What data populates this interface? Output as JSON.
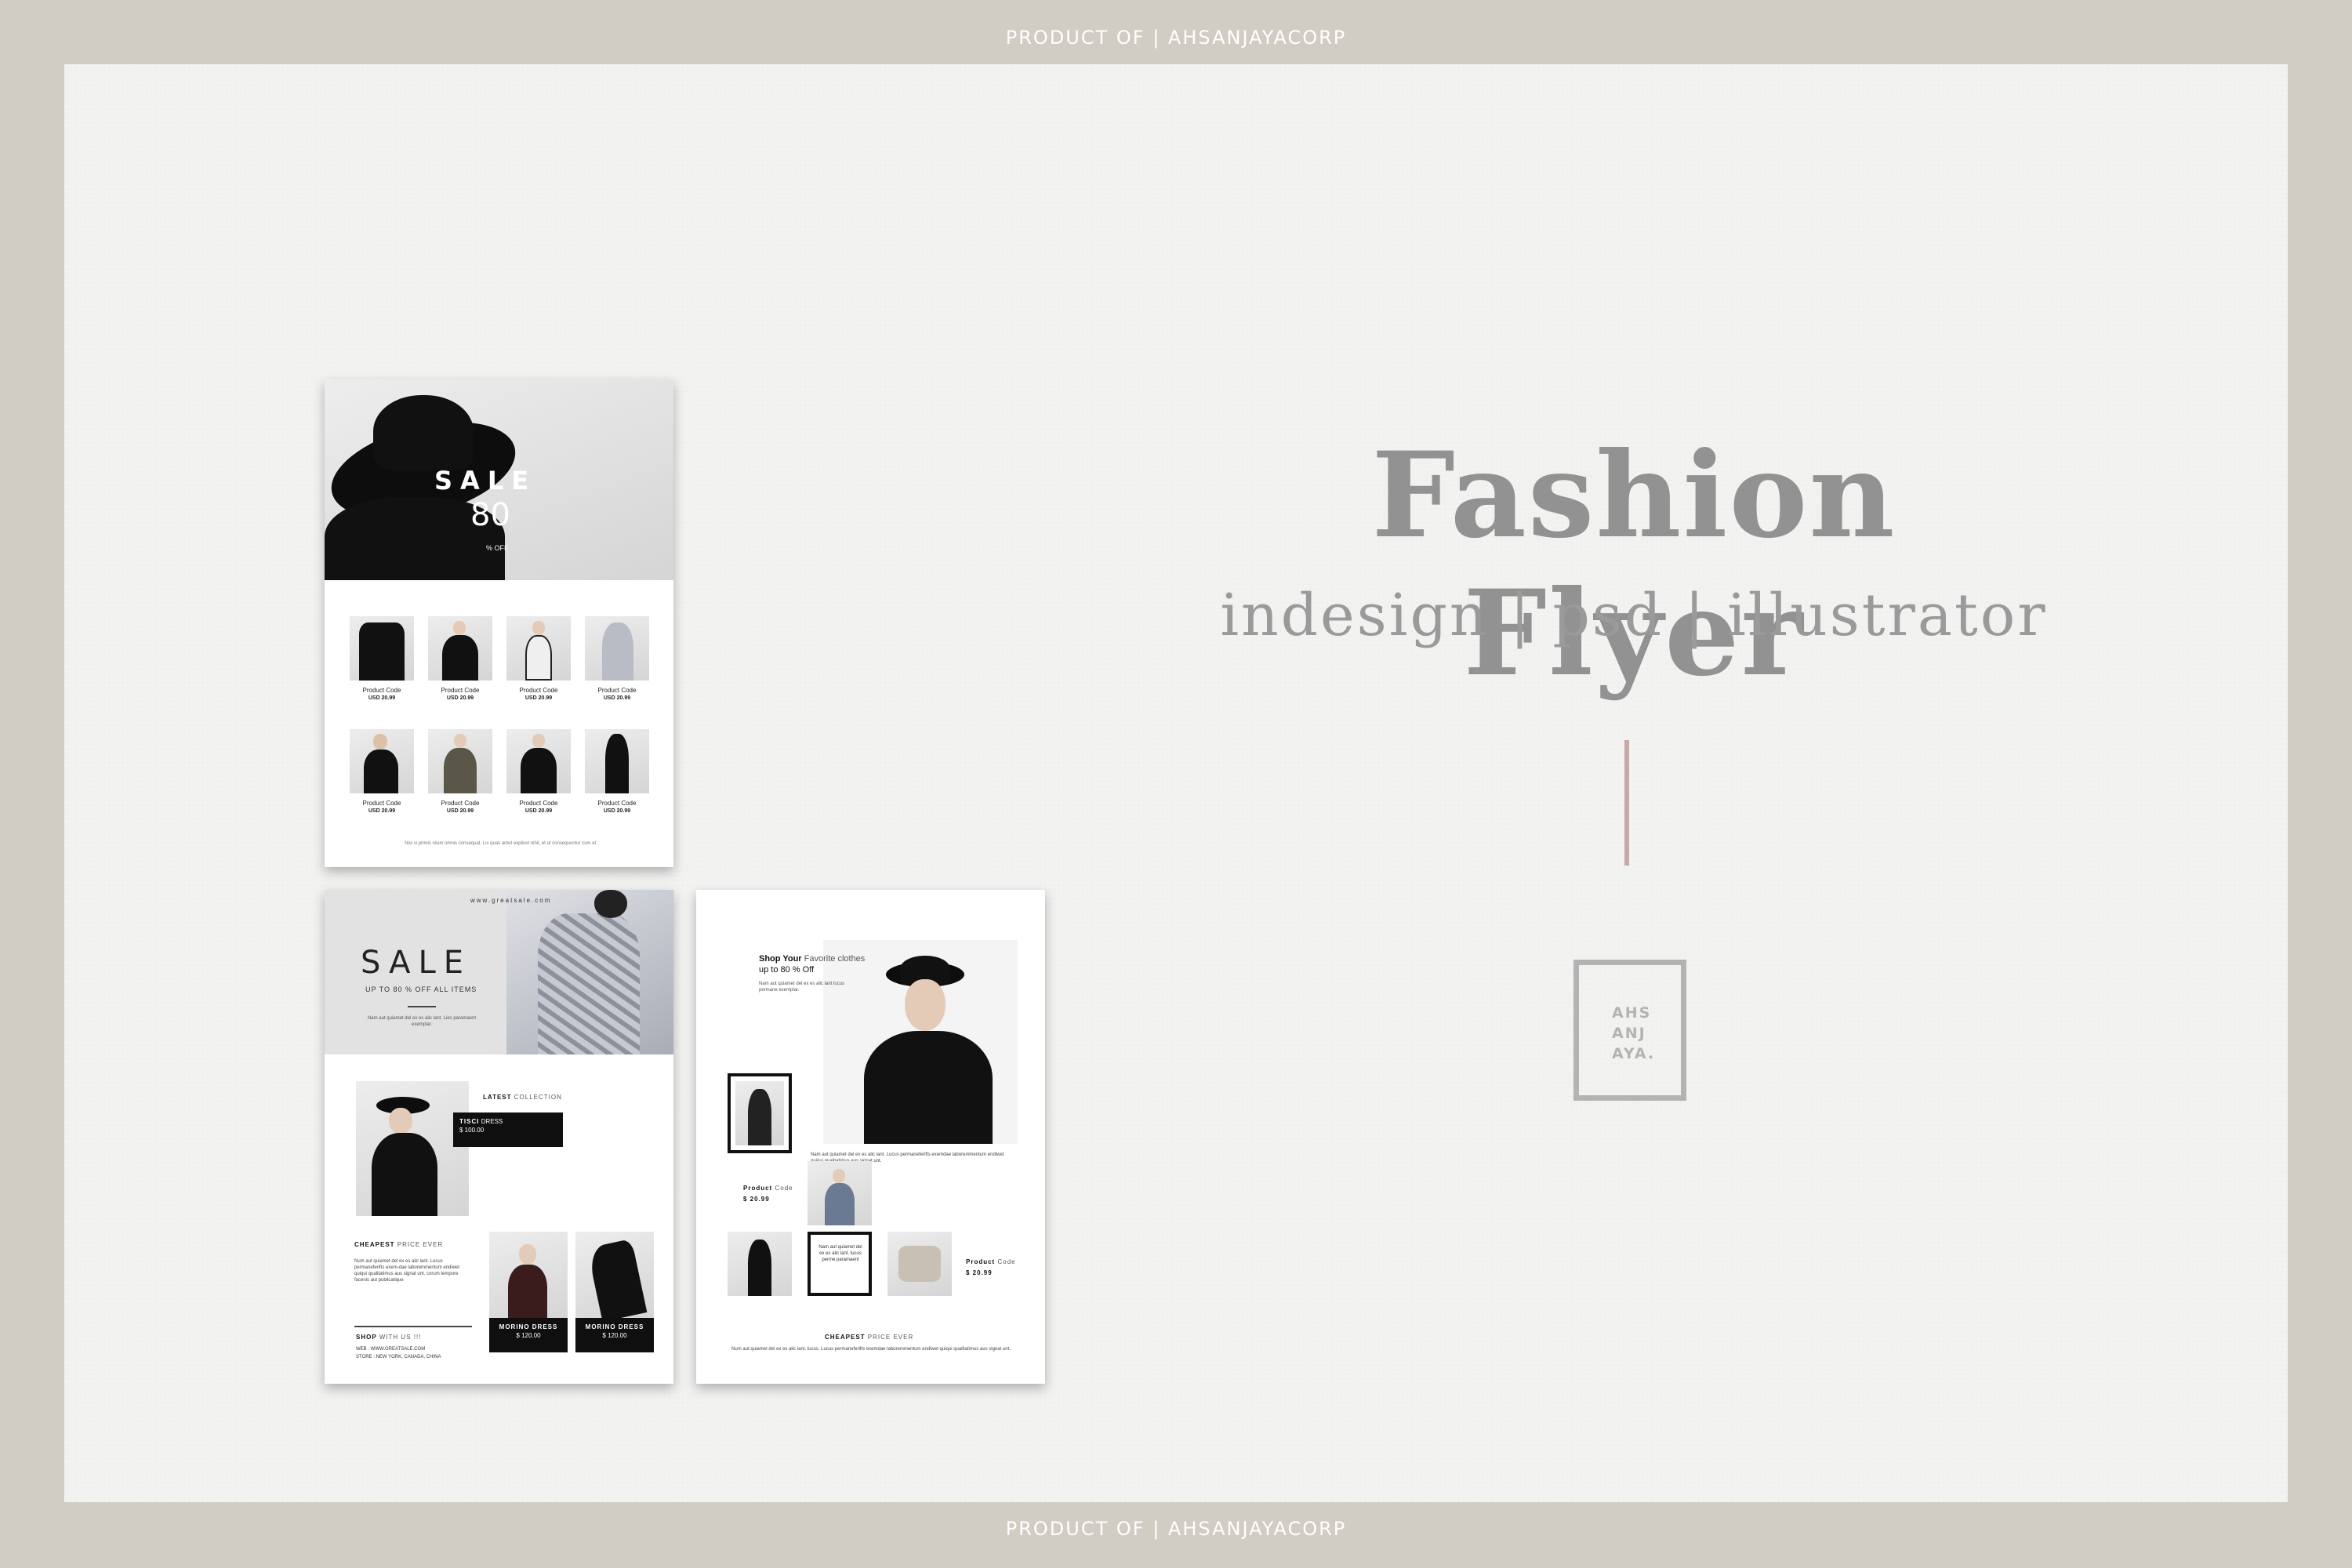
{
  "banner": {
    "top_text": "PRODUCT OF | AHSANJAYACORP",
    "bottom_text": "PRODUCT OF | AHSANJAYACORP"
  },
  "hero": {
    "title": "Fashion Flyer",
    "subtitle": "indesign | psd | illustrator",
    "accent_color": "#c4a9a4"
  },
  "logo": {
    "line1": "AHS",
    "line2": "ANJ",
    "line3": "AYA."
  },
  "flyer1": {
    "sale": "SALE",
    "discount": "80",
    "off": "% OFF",
    "products": [
      {
        "name": "Product Code",
        "price": "USD 20.99"
      },
      {
        "name": "Product Code",
        "price": "USD 20.99"
      },
      {
        "name": "Product Code",
        "price": "USD 20.99"
      },
      {
        "name": "Product Code",
        "price": "USD 20.99"
      },
      {
        "name": "Product Code",
        "price": "USD 20.99"
      },
      {
        "name": "Product Code",
        "price": "USD 20.99"
      },
      {
        "name": "Product Code",
        "price": "USD 20.99"
      },
      {
        "name": "Product Code",
        "price": "USD 20.99"
      }
    ],
    "footer": "Nisi si primis nisim omnis consequat. Lis quas amet explicet nihil, et ut consequuntur cum et."
  },
  "flyer2": {
    "url": "www.greatsale.com",
    "sale": "SALE",
    "sale_sub": "UP TO 80 % OFF ALL ITEMS",
    "intro": "Nam aut quiamet del ex es alic lant. Lies paramaent exemplar.",
    "latest_bold": "LATEST",
    "latest_rest": "COLLECTION",
    "tisci_bold": "TISCI",
    "tisci_rest": "DRESS",
    "tisci_price": "$ 100.00",
    "cheapest_bold": "CHEAPEST",
    "cheapest_rest": "PRICE EVER",
    "cheapest_body": "Num aut quiamet del ex es ailc lant. Lucus permaneferifts exem-dae laboremmentum endiwet quiqui qualitatimus aus signat unt. corum tempore facenis aut publicatique",
    "shop_bold": "SHOP",
    "shop_rest": "WITH US !!!",
    "web": "WEB : WWW.GREATSALE.COM",
    "store": "STORE : NEW YORK, CANADA, CHINA",
    "item_a": "MORINO DRESS",
    "item_a_price": "$ 120.00",
    "item_b": "MORINO DRESS",
    "item_b_price": "$ 120.00"
  },
  "flyer3": {
    "shop_bold": "Shop Your",
    "shop_rest": "Favorite clothes",
    "up_to": "up to 80 % Off",
    "intro": "Nam aut quiamet del ex es alic lant lucus permane exemplar.",
    "body": "Nam aut quiamet del ex es alic lant. Lucus permaneferifts exemdae laboremmentum endiwet quiqui qualitatimus aus signat unt.",
    "product_a_bold": "Product",
    "product_a_rest": "Code",
    "product_a_price": "$ 20.99",
    "product_b_bold": "Product",
    "product_b_rest": "Code",
    "product_b_price": "$ 20.99",
    "box_text": "Nam aut quiamet del ex es alic lant. lucus perme paramaent",
    "cheapest_bold": "CHEAPEST",
    "cheapest_rest": "PRICE EVER",
    "footer": "Num aut quiamet del ex es alic lant. lucus. Lucus permaneferifts exemdae laboremmentum endiwet quiqui qualitatimus aus signat unt."
  }
}
